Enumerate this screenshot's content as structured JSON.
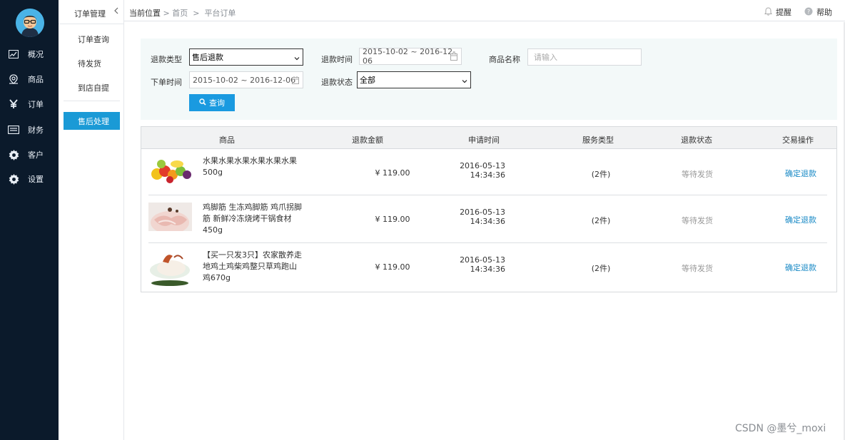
{
  "nav": {
    "items": [
      {
        "label": "概况",
        "icon": "chart-line-icon"
      },
      {
        "label": "商品",
        "icon": "tag-icon"
      },
      {
        "label": "订单",
        "icon": "yen-icon"
      },
      {
        "label": "财务",
        "icon": "card-icon"
      },
      {
        "label": "客户",
        "icon": "gear-icon"
      },
      {
        "label": "设置",
        "icon": "gear-icon"
      }
    ]
  },
  "submenu": {
    "title": "订单管理",
    "items": [
      "订单查询",
      "待发货",
      "到店自提"
    ],
    "active": "售后处理"
  },
  "breadcrumb": {
    "label": "当前位置",
    "home": "首页",
    "current": "平台订单",
    "sep": ">"
  },
  "topbar": {
    "remind": "提醒",
    "help": "帮助"
  },
  "filter": {
    "refund_type_label": "退款类型",
    "refund_type_value": "售后退款",
    "refund_time_label": "退款时间",
    "refund_time_value": "2015-10-02 ~ 2016-12-06",
    "product_name_label": "商品名称",
    "product_name_placeholder": "请输入",
    "order_time_label": "下单时间",
    "order_time_value": "2015-10-02 ~ 2016-12-06",
    "refund_status_label": "退款状态",
    "refund_status_value": "全部",
    "query_button": "查询"
  },
  "table": {
    "headers": [
      "商品",
      "退款金额",
      "申请时间",
      "服务类型",
      "退款状态",
      "交易操作"
    ],
    "rows": [
      {
        "name": "水果水果水果水果水果水果500g",
        "amount": "¥ 119.00",
        "date": "2016-05-13",
        "time": "14:34:36",
        "service": "(2件)",
        "status": "等待发货",
        "action": "确定退款"
      },
      {
        "name": "鸡脚筋 生冻鸡脚筋 鸡爪拐脚筋 新鲜冷冻烧烤干锅食材450g",
        "amount": "¥ 119.00",
        "date": "2016-05-13",
        "time": "14:34:36",
        "service": "(2件)",
        "status": "等待发货",
        "action": "确定退款"
      },
      {
        "name": "【买一只发3只】农家散养走地鸡土鸡柴鸡整只草鸡跑山鸡670g",
        "amount": "¥ 119.00",
        "date": "2016-05-13",
        "time": "14:34:36",
        "service": "(2件)",
        "status": "等待发货",
        "action": "确定退款"
      }
    ]
  },
  "watermark": "CSDN @墨兮_moxi"
}
